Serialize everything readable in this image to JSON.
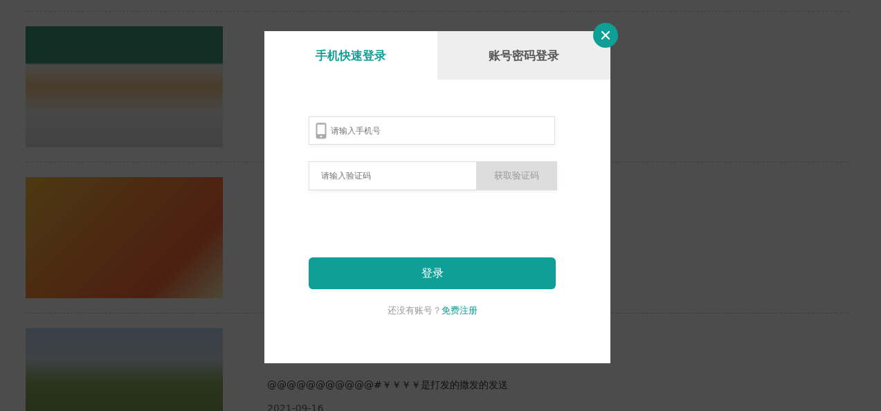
{
  "articles": [
    {
      "kind": "image"
    },
    {
      "kind": "image"
    },
    {
      "kind": "image_text",
      "text": "@@@@@@@@@@@#￥￥￥￥是打发的撒发的发送",
      "date": "2021-09-16"
    }
  ],
  "login_dialog": {
    "tabs": [
      {
        "label": "手机快速登录",
        "selected": true
      },
      {
        "label": "账号密码登录",
        "selected": false
      }
    ],
    "phone_field": {
      "placeholder": "请输入手机号"
    },
    "code_field": {
      "placeholder": "请输入验证码"
    },
    "get_code_button": {
      "label": "获取验证码",
      "disabled": true
    },
    "login_button": {
      "label": "登录"
    },
    "register": {
      "prompt": "还没有账号？",
      "link": "免费注册"
    }
  }
}
